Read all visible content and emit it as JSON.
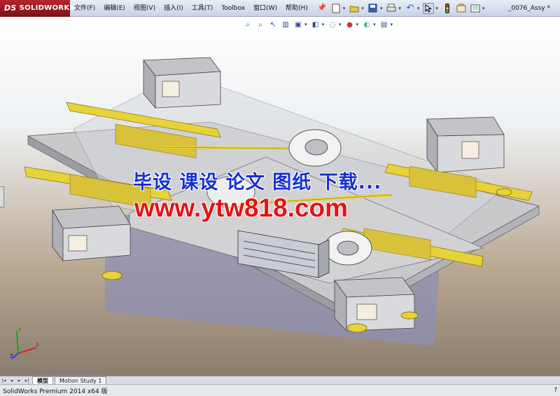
{
  "app": {
    "logo_text": "SOLIDWORKS",
    "logo_prefix": "DS",
    "document_title": "_0076_Assy *"
  },
  "menu": {
    "items": [
      {
        "label": "文件(F)"
      },
      {
        "label": "编辑(E)"
      },
      {
        "label": "视图(V)"
      },
      {
        "label": "插入(I)"
      },
      {
        "label": "工具(T)"
      },
      {
        "label": "Toolbox"
      },
      {
        "label": "窗口(W)"
      },
      {
        "label": "帮助(H)"
      }
    ]
  },
  "toolbar_top_icons": [
    "pin-icon",
    "new-document-icon",
    "open-icon",
    "save-icon",
    "print-icon",
    "undo-icon",
    "select-icon",
    "rebuild-icon",
    "file-properties-icon",
    "options-icon"
  ],
  "heads_up_icons": [
    "zoom-to-fit-icon",
    "zoom-to-area-icon",
    "previous-view-icon",
    "section-view-icon",
    "view-orientation-icon",
    "display-style-icon",
    "hide-show-icon",
    "edit-appearance-icon",
    "apply-scene-icon",
    "view-settings-icon"
  ],
  "watermark": {
    "line1": "毕设 课设 论文 图纸 下载...",
    "line2": "www.ytw818.com"
  },
  "triad": {
    "x": "X",
    "y": "Y",
    "z": "Z"
  },
  "tabs": [
    {
      "label": "模型",
      "active": true
    },
    {
      "label": "Motion Study 1",
      "active": false
    }
  ],
  "status": {
    "text": "SolidWorks Premium 2014 x64 版",
    "right": "?"
  },
  "colors": {
    "brand_red": "#b4272c",
    "rail_yellow": "#e8d23a",
    "watermark_blue": "#1530d0",
    "watermark_red": "#e01515"
  }
}
